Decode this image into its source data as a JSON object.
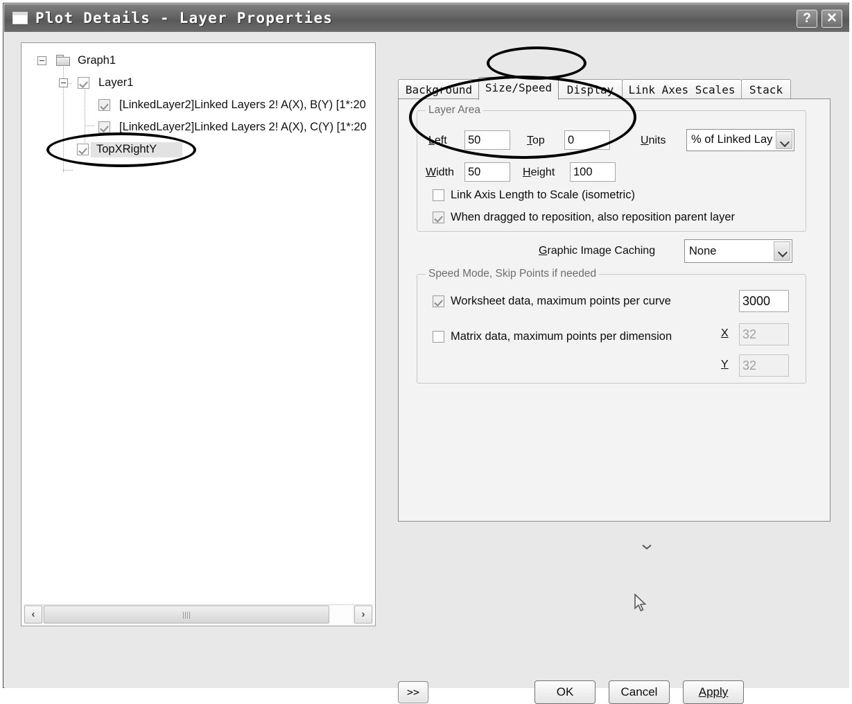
{
  "window": {
    "title": "Plot Details - Layer Properties",
    "icon": "window-icon",
    "help_button": "?",
    "close_button": "✕"
  },
  "tree": {
    "nodes": [
      {
        "label": "Graph1",
        "type": "folder",
        "expander": "minus",
        "checkbox": null,
        "selected": false
      },
      {
        "label": "Layer1",
        "type": "layer",
        "expander": "minus",
        "checkbox": "checked",
        "selected": false
      },
      {
        "label": "[LinkedLayer2]Linked Layers 2! A(X), B(Y) [1*:20",
        "type": "plot",
        "expander": null,
        "checkbox": "checked",
        "selected": false
      },
      {
        "label": "[LinkedLayer2]Linked Layers 2! A(X), C(Y) [1*:20",
        "type": "plot",
        "expander": null,
        "checkbox": "checked",
        "selected": false
      },
      {
        "label": "TopXRightY",
        "type": "layer",
        "expander": null,
        "checkbox": "checked",
        "selected": true
      }
    ],
    "scrollbar": {
      "left_arrow": "‹",
      "right_arrow": "›"
    }
  },
  "tabs": [
    {
      "label": "Background",
      "active": false
    },
    {
      "label": "Size/Speed",
      "active": true
    },
    {
      "label": "Display",
      "active": false
    },
    {
      "label": "Link Axes Scales",
      "active": false
    },
    {
      "label": "Stack",
      "active": false
    }
  ],
  "layer_area": {
    "title": "Layer Area",
    "left_label": "Left",
    "left_value": "50",
    "top_label": "Top",
    "top_value": "0",
    "width_label": "Width",
    "width_value": "50",
    "height_label": "Height",
    "height_value": "100",
    "units_label": "Units",
    "units_value": "% of Linked Lay",
    "link_axis_label": "Link Axis Length to Scale (isometric)",
    "link_axis_checked": false,
    "reposition_label": "When dragged to reposition, also reposition parent layer",
    "reposition_checked": true
  },
  "graphic_caching": {
    "label": "Graphic Image Caching",
    "value": "None"
  },
  "speed_mode": {
    "title": "Speed Mode, Skip Points if needed",
    "worksheet_label": "Worksheet data, maximum points per curve",
    "worksheet_checked": true,
    "worksheet_value": "3000",
    "matrix_label": "Matrix data, maximum points per dimension",
    "matrix_checked": false,
    "matrix_x_label": "X",
    "matrix_x_value": "32",
    "matrix_y_label": "Y",
    "matrix_y_value": "32"
  },
  "buttons": {
    "expand": ">>",
    "ok": "OK",
    "cancel": "Cancel",
    "apply": "Apply"
  },
  "colors": {
    "dialog_bg": "#e8e8e8",
    "panel_bg": "#f3f3f3",
    "titlebar": "#5a5a5a",
    "annotation": "#000000"
  }
}
